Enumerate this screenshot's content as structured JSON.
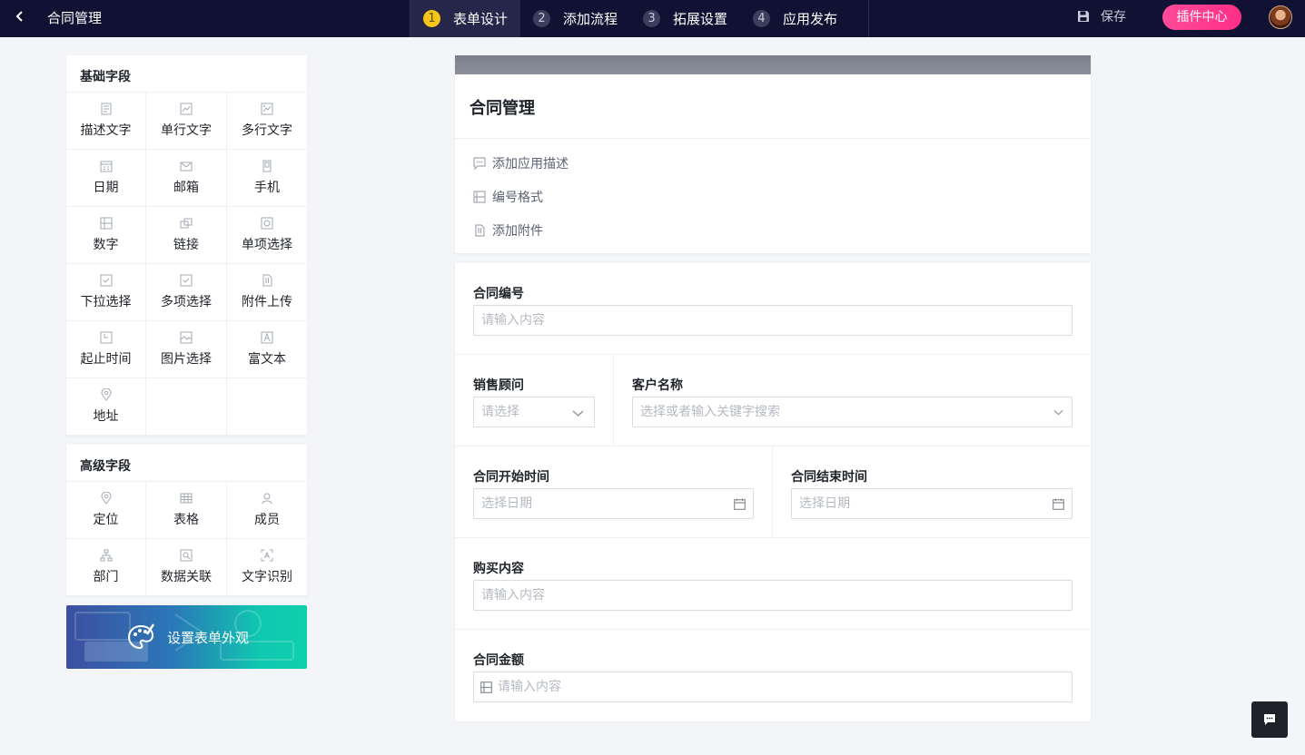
{
  "topbar": {
    "app_title": "合同管理",
    "steps": [
      {
        "num": "1",
        "label": "表单设计"
      },
      {
        "num": "2",
        "label": "添加流程"
      },
      {
        "num": "3",
        "label": "拓展设置"
      },
      {
        "num": "4",
        "label": "应用发布"
      }
    ],
    "save_label": "保存",
    "plugin_label": "插件中心"
  },
  "basic_fields": {
    "title": "基础字段",
    "items": [
      {
        "label": "描述文字",
        "icon": "description-icon"
      },
      {
        "label": "单行文字",
        "icon": "single-line-icon"
      },
      {
        "label": "多行文字",
        "icon": "multi-line-icon"
      },
      {
        "label": "日期",
        "icon": "date-icon"
      },
      {
        "label": "邮箱",
        "icon": "email-icon"
      },
      {
        "label": "手机",
        "icon": "phone-icon"
      },
      {
        "label": "数字",
        "icon": "number-icon"
      },
      {
        "label": "链接",
        "icon": "link-icon"
      },
      {
        "label": "单项选择",
        "icon": "radio-icon"
      },
      {
        "label": "下拉选择",
        "icon": "dropdown-icon"
      },
      {
        "label": "多项选择",
        "icon": "checkbox-icon"
      },
      {
        "label": "附件上传",
        "icon": "attachment-icon"
      },
      {
        "label": "起止时间",
        "icon": "time-range-icon"
      },
      {
        "label": "图片选择",
        "icon": "image-icon"
      },
      {
        "label": "富文本",
        "icon": "rich-text-icon"
      },
      {
        "label": "地址",
        "icon": "address-icon"
      }
    ]
  },
  "advanced_fields": {
    "title": "高级字段",
    "items": [
      {
        "label": "定位",
        "icon": "location-icon"
      },
      {
        "label": "表格",
        "icon": "table-icon"
      },
      {
        "label": "成员",
        "icon": "member-icon"
      },
      {
        "label": "部门",
        "icon": "department-icon"
      },
      {
        "label": "数据关联",
        "icon": "data-link-icon"
      },
      {
        "label": "文字识别",
        "icon": "ocr-icon"
      }
    ]
  },
  "appearance_label": "设置表单外观",
  "form_header": {
    "title": "合同管理",
    "actions": [
      {
        "label": "添加应用描述",
        "icon": "comment-icon"
      },
      {
        "label": "编号格式",
        "icon": "number-format-icon"
      },
      {
        "label": "添加附件",
        "icon": "attachment-icon"
      }
    ]
  },
  "form": {
    "contract_no": {
      "label": "合同编号",
      "placeholder": "请输入内容"
    },
    "sales_advisor": {
      "label": "销售顾问",
      "placeholder": "请选择"
    },
    "customer_name": {
      "label": "客户名称",
      "placeholder": "选择或者输入关键字搜索"
    },
    "start_date": {
      "label": "合同开始时间",
      "placeholder": "选择日期"
    },
    "end_date": {
      "label": "合同结束时间",
      "placeholder": "选择日期"
    },
    "purchase": {
      "label": "购买内容",
      "placeholder": "请输入内容"
    },
    "amount": {
      "label": "合同金额",
      "placeholder": "请输入内容"
    }
  },
  "colors": {
    "topbar_bg": "#101133",
    "active_step_badge": "#f5c518",
    "plugin_button": "#ff2e86",
    "appearance_gradient_start": "#3d4fa0",
    "appearance_gradient_end": "#0fd0ad"
  }
}
